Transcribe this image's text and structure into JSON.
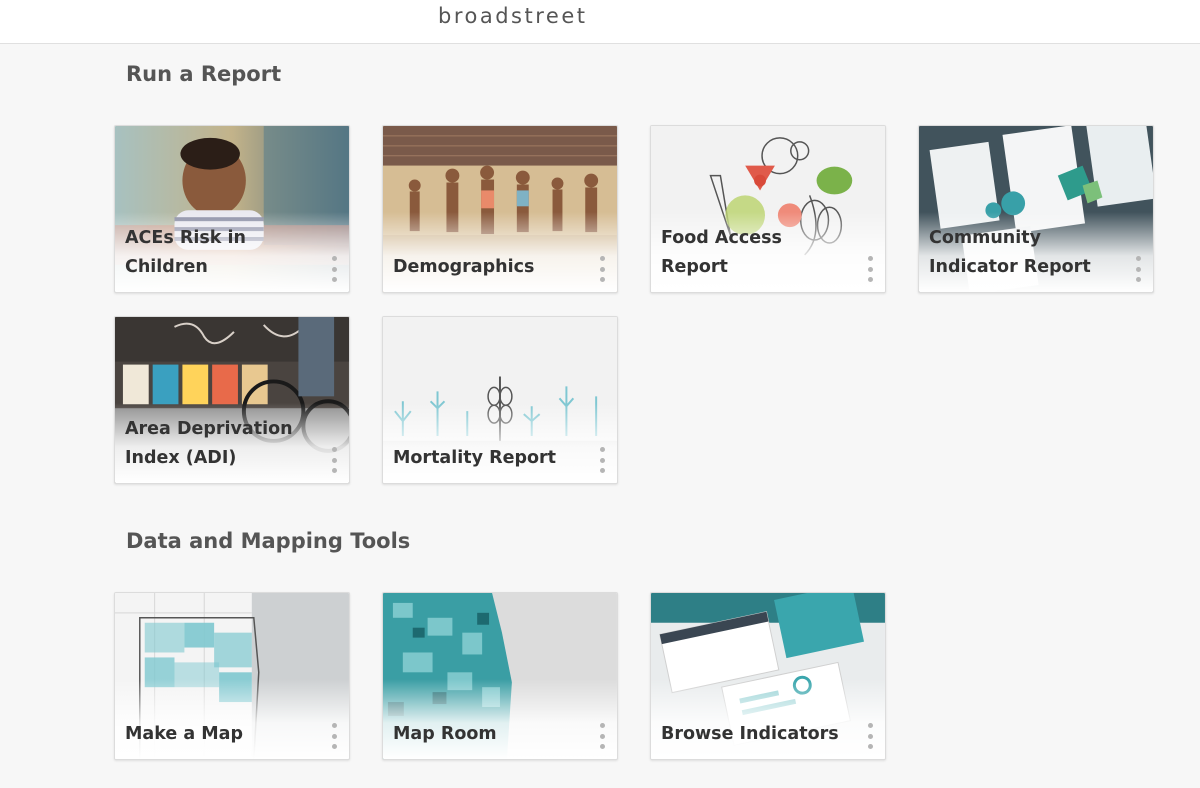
{
  "header": {
    "logo_text": "broadstreet"
  },
  "sections": {
    "reports": {
      "title": "Run a Report",
      "cards": [
        {
          "label": "ACEs Risk in Children",
          "menu_icon": "more-vertical-icon"
        },
        {
          "label": "Demographics",
          "menu_icon": "more-vertical-icon"
        },
        {
          "label": "Food Access Report",
          "menu_icon": "more-vertical-icon"
        },
        {
          "label": "Community Indicator Report",
          "menu_icon": "more-vertical-icon"
        },
        {
          "label": "Area Deprivation Index (ADI)",
          "menu_icon": "more-vertical-icon"
        },
        {
          "label": "Mortality Report",
          "menu_icon": "more-vertical-icon"
        }
      ]
    },
    "tools": {
      "title": "Data and Mapping Tools",
      "cards": [
        {
          "label": "Make a Map",
          "menu_icon": "more-vertical-icon"
        },
        {
          "label": "Map Room",
          "menu_icon": "more-vertical-icon"
        },
        {
          "label": "Browse Indicators",
          "menu_icon": "more-vertical-icon"
        }
      ]
    }
  },
  "colors": {
    "teal": "#2e9ba0",
    "background": "#f7f7f7",
    "text": "#333333"
  }
}
